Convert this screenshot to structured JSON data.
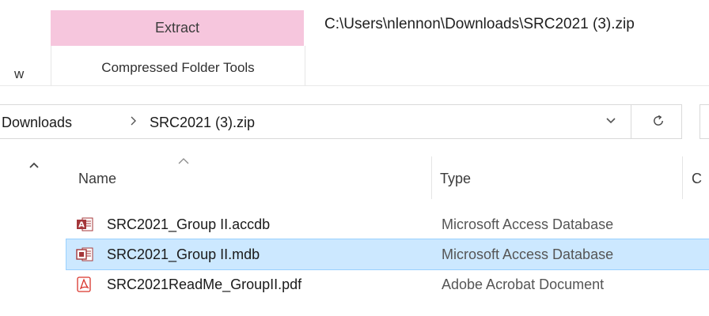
{
  "ribbon": {
    "active_tab": "Extract",
    "contextual_group_label": "Compressed Folder Tools",
    "partial_tab": "w",
    "window_path": "C:\\Users\\nlennon\\Downloads\\SRC2021 (3).zip",
    "active_tab_color": "#f6c6dd"
  },
  "address_bar": {
    "breadcrumbs": [
      "Downloads",
      "SRC2021 (3).zip"
    ],
    "separator": ">",
    "dropdown_icon": "chevron-down-icon",
    "refresh_icon": "refresh-icon"
  },
  "columns": {
    "name": "Name",
    "type": "Type",
    "partial": "C"
  },
  "files": [
    {
      "name": "SRC2021_Group II.accdb",
      "type": "Microsoft Access Database",
      "icon": "access-accdb-icon",
      "selected": false
    },
    {
      "name": "SRC2021_Group II.mdb",
      "type": "Microsoft Access Database",
      "icon": "access-mdb-icon",
      "selected": true
    },
    {
      "name": "SRC2021ReadMe_GroupII.pdf",
      "type": "Adobe Acrobat Document",
      "icon": "pdf-icon",
      "selected": false
    }
  ],
  "colors": {
    "selection_background": "#cce8ff",
    "selection_border": "#99d1ff",
    "access_red": "#a4373a",
    "pdf_red": "#d9342b"
  }
}
